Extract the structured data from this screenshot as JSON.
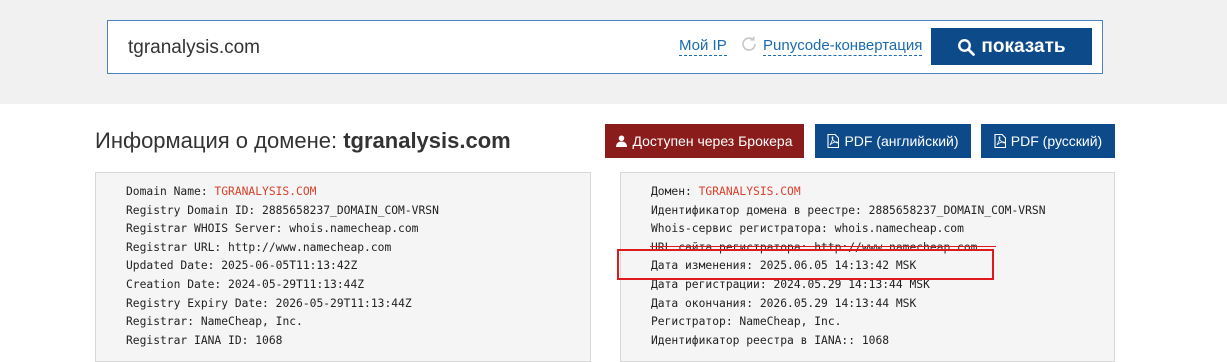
{
  "search": {
    "value": "tgranalysis.com",
    "my_ip_label": "Мой IP",
    "punycode_label": "Punycode-конвертация",
    "show_label": "показать"
  },
  "header": {
    "title_prefix": "Информация о домене: ",
    "domain": "tgranalysis.com",
    "broker_label": "Доступен через Брокера",
    "pdf_en_label": "PDF (английский)",
    "pdf_ru_label": "PDF (русский)"
  },
  "whois_en": [
    {
      "label": "Domain Name: ",
      "value": "TGRANALYSIS.COM",
      "red": true
    },
    {
      "label": "Registry Domain ID: ",
      "value": "2885658237_DOMAIN_COM-VRSN"
    },
    {
      "label": "Registrar WHOIS Server: ",
      "value": "whois.namecheap.com"
    },
    {
      "label": "Registrar URL: ",
      "value": "http://www.namecheap.com"
    },
    {
      "label": "Updated Date: ",
      "value": "2025-06-05T11:13:42Z"
    },
    {
      "label": "Creation Date: ",
      "value": "2024-05-29T11:13:44Z"
    },
    {
      "label": "Registry Expiry Date: ",
      "value": "2026-05-29T11:13:44Z"
    },
    {
      "label": "Registrar: ",
      "value": "NameCheap, Inc."
    },
    {
      "label": "Registrar IANA ID: ",
      "value": "1068"
    }
  ],
  "whois_ru": [
    {
      "label": "Домен: ",
      "value": "TGRANALYSIS.COM",
      "red": true
    },
    {
      "label": "Идентификатор домена в реестре: ",
      "value": "2885658237_DOMAIN_COM-VRSN"
    },
    {
      "label": "Whois-сервис регистратора: ",
      "value": "whois.namecheap.com"
    },
    {
      "label": "URL сайта регистратора: ",
      "value": "http://www.namecheap.com"
    },
    {
      "label": "Дата изменения: ",
      "value": "2025.06.05 14:13:42 MSK"
    },
    {
      "label": "Дата регистрации: ",
      "value": "2024.05.29 14:13:44 MSK"
    },
    {
      "label": "Дата окончания: ",
      "value": "2026.05.29 14:13:44 MSK"
    },
    {
      "label": "Регистратор: ",
      "value": "NameCheap, Inc."
    },
    {
      "label": "Идентификатор реестра в IANA:: ",
      "value": "1068"
    }
  ],
  "colors": {
    "primary": "#0d4a8a",
    "broker": "#8a1c1c",
    "link": "#1a6bb0",
    "highlight": "#e0191c",
    "domain_red": "#d9412c"
  }
}
